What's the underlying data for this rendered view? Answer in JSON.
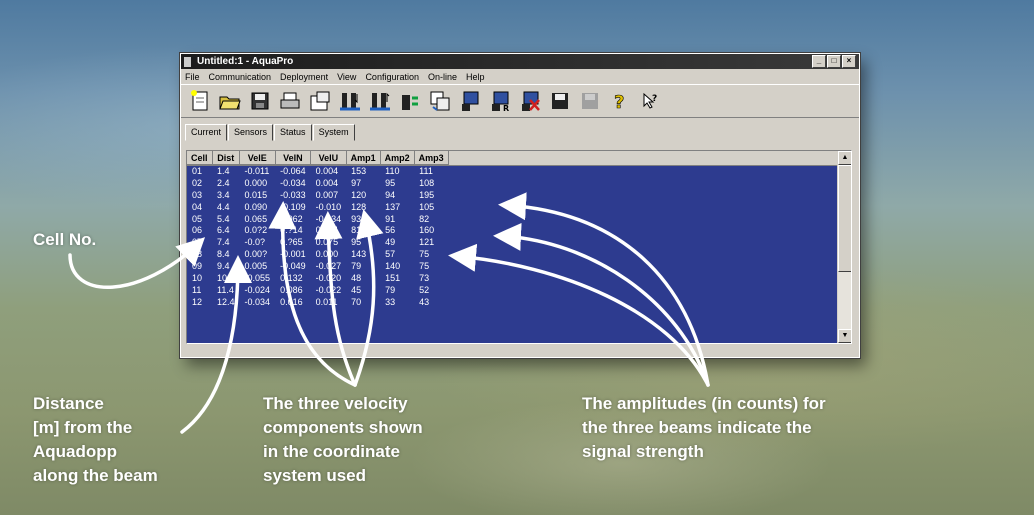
{
  "window": {
    "title": "Untitled:1 - AquaPro",
    "controls": [
      "_",
      "□",
      "×"
    ]
  },
  "menu": [
    "File",
    "Communication",
    "Deployment",
    "View",
    "Configuration",
    "On-line",
    "Help"
  ],
  "toolbar": {
    "icons": [
      "new-file-icon",
      "open-folder-icon",
      "save-disk-icon",
      "print-icon",
      "device-config-icon",
      "download-icon",
      "upload-icon",
      "data-transfer-icon",
      "convert-icon",
      "start-recorder-icon",
      "recorder-r-icon",
      "stop-recorder-icon",
      "disk-icon",
      "disabled-icon",
      "help-icon",
      "context-help-icon"
    ]
  },
  "tabs": [
    "Current",
    "Sensors",
    "Status",
    "System"
  ],
  "table": {
    "columns": [
      "Cell",
      "Dist",
      "VelE",
      "VelN",
      "VelU",
      "Amp1",
      "Amp2",
      "Amp3"
    ],
    "rows": [
      [
        "01",
        "1.4",
        "-0.011",
        "-0.064",
        "0.004",
        "153",
        "110",
        "111"
      ],
      [
        "02",
        "2.4",
        "0.000",
        "-0.034",
        "0.004",
        "97",
        "95",
        "108"
      ],
      [
        "03",
        "3.4",
        "0.015",
        "-0.033",
        "0.007",
        "120",
        "94",
        "195"
      ],
      [
        "04",
        "4.4",
        "0.090",
        "-0.109",
        "-0.010",
        "128",
        "137",
        "105"
      ],
      [
        "05",
        "5.4",
        "0.065",
        "0.062",
        "-0.034",
        "93",
        "91",
        "82"
      ],
      [
        "06",
        "6.4",
        "0.0?2",
        "0.?14",
        "0.084",
        "81",
        "56",
        "160"
      ],
      [
        "07",
        "7.4",
        "-0.0?",
        "0.?65",
        "0.075",
        "95",
        "49",
        "121"
      ],
      [
        "08",
        "8.4",
        "0.00?",
        "-0.001",
        "0.000",
        "143",
        "57",
        "75"
      ],
      [
        "09",
        "9.4",
        "0.005",
        "-0.049",
        "-0.027",
        "79",
        "140",
        "75"
      ],
      [
        "10",
        "10.4",
        "-0.055",
        "0.132",
        "-0.020",
        "48",
        "151",
        "73"
      ],
      [
        "11",
        "11.4",
        "-0.024",
        "0.086",
        "-0.022",
        "45",
        "79",
        "52"
      ],
      [
        "12",
        "12.4",
        "-0.034",
        "0.016",
        "0.011",
        "70",
        "33",
        "43"
      ]
    ]
  },
  "callouts": {
    "cell_no": "Cell No.",
    "distance": [
      "Distance",
      "[m] from the",
      "Aquadopp",
      "along the beam"
    ],
    "velocity": [
      "The three velocity",
      "components shown",
      "in the coordinate",
      "system used"
    ],
    "amplitude": [
      "The amplitudes (in counts) for",
      "the three beams indicate the",
      "signal strength"
    ]
  },
  "colors": {
    "grid_bg": "#2d3b8f",
    "window_face": "#d4d0c8",
    "callout_text": "#ffffff"
  }
}
